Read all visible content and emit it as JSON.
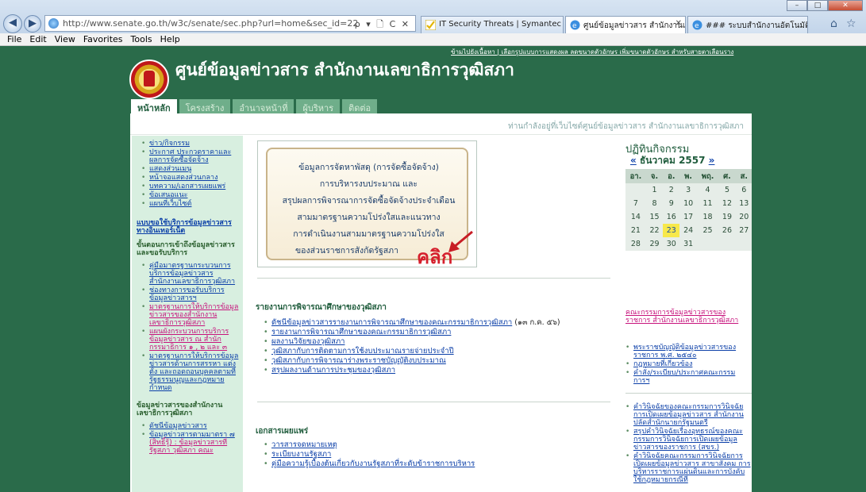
{
  "browser": {
    "url": "http://www.senate.go.th/w3c/senate/sec.php?url=home&sec_id=22",
    "address_tools": "ρ ▾ 🗋 C ✕",
    "tabs": [
      {
        "label": "IT Security Threats | Symantec",
        "icon": "checkmark-icon"
      },
      {
        "label": "ศูนย์ข้อมูลข่าวสาร สำนักงานเล...",
        "icon": "ie-icon"
      },
      {
        "label": "### ระบบสำนักงานอัตโนมัติ ###",
        "icon": "ie-icon"
      }
    ],
    "menu": [
      "File",
      "Edit",
      "View",
      "Favorites",
      "Tools",
      "Help"
    ]
  },
  "site": {
    "top_links": "ข้ามไปยังเนื้อหา | เลือกรูปแบบการแสดงผล ลดขนาดตัวอักษร เพิ่มขนาดตัวอักษร สำหรับสายตาเลือนราง",
    "title": "ศูนย์ข้อมูลข่าวสาร สำนักงานเลขาธิการวุฒิสภา",
    "tabs": [
      "หน้าหลัก",
      "โครงสร้าง",
      "อำนาจหน้าที่",
      "ผู้บริหาร",
      "ติดต่อ"
    ],
    "welcome": "ท่านกำลังอยู่ที่เว็บไซต์ศูนย์ข้อมูลข่าวสาร สำนักงานเลขาธิการวุฒิสภา"
  },
  "left": {
    "menu": [
      "ข่าว/กิจกรรม",
      "ประกาศ ประกวดราคาและผลการจัดซื้อจัดจ้าง",
      "แสดงส่วนเมนู",
      "หน้าจอแสดงส่วนกลาง",
      "บทความ/เอกสารเผยแพร่",
      "ข้อเสนอแนะ",
      "แผนที่เว็บไซต์"
    ],
    "online_form": "แบบขอใช้บริการข้อมูลข่าวสารทางอินเทอร์เน็ต",
    "access_head": "ขั้นตอนการเข้าถึงข้อมูลข่าวสารและขอรับบริการ",
    "access": [
      {
        "label": "คู่มือมาตรฐานกระบวนการบริการข้อมูลข่าวสาร สำนักงานเลขาธิการวุฒิสภา",
        "alt": false
      },
      {
        "label": "ช่องทางการขอรับบริการข้อมูลข่าวสารฯ",
        "alt": false
      },
      {
        "label": "มาตรฐานการให้บริการข้อมูลข่าวสารของสำนักงานเลขาธิการวุฒิสภา",
        "alt": true
      },
      {
        "label": "แผนผังกระบวนการบริการข้อมูลข่าวสาร ณ สำนักกรรมาธิการ ๑ , ๒ และ ๓",
        "alt": true
      },
      {
        "label": "มาตรฐานการให้บริการข้อมูลข่าวสารด้านการสรรหา แต่งตั้ง และถอดถอนบุคคลตามที่รัฐธรรมนูญและกฎหมายกำหนด",
        "alt": false
      }
    ],
    "office_head": "ข้อมูลข่าวสารของสำนักงานเลขาธิการวุฒิสภา",
    "office": [
      {
        "label": "ดัชนีข้อมูลข่าวสาร",
        "alt": false
      },
      {
        "label": "ข้อมูลข่าวสารตามมาตรา ๗",
        "alt": false
      },
      {
        "label": "(สิทธิ์รู้) : ข้อมูลข่าวสารที่รัฐสภา วุฒิสภา คณะ",
        "alt": true
      }
    ]
  },
  "banner": {
    "lines": [
      "ข้อมูลการจัดหาพัสดุ (การจัดซื้อจัดจ้าง)",
      "การบริหารงบประมาณ และ",
      "สรุปผลการพิจารณาการจัดซื้อจัดจ้างประจำเดือน",
      "สามมาตรฐานความโปร่งใสและแนวทาง",
      "การดำเนินงานสามมาตรฐานความโปร่งใส",
      "ของส่วนราชการสังกัดรัฐสภา"
    ],
    "click_label": "คลิก"
  },
  "reports": {
    "heading": "รายงานการพิจารณาศึกษาของวุฒิสภา",
    "items": [
      {
        "label": "ดัชนีข้อมูลข่าวสารรายงานการพิจารณาศึกษาของคณะกรรมาธิการวุฒิสภา",
        "note": " (๑๓ ก.ค. ๕๖)"
      },
      {
        "label": "รายงานการพิจารณาศึกษาของคณะกรรมาธิการวุฒิสภา",
        "note": ""
      },
      {
        "label": "ผลงานวิจัยของวุฒิสภา",
        "note": ""
      },
      {
        "label": "วุฒิสภากับการติดตามการใช้งบประมาณรายจ่ายประจำปี",
        "note": ""
      },
      {
        "label": "วุฒิสภากับการพิจารณาร่างพระราชบัญญัติงบประมาณ",
        "note": ""
      },
      {
        "label": "สรุปผลงานด้านการประชุมของวุฒิสภา",
        "note": ""
      }
    ]
  },
  "publications": {
    "heading": "เอกสารเผยแพร่",
    "items": [
      "วารสารจดหมายเหตุ",
      "ระเบียบงานรัฐสภา",
      "คู่มือความรู้เบื้องต้นเกี่ยวกับงานรัฐสภาที่ระดับข้าราชการบริหาร"
    ]
  },
  "calendar": {
    "title": "ปฏิทินกิจกรรม",
    "prev": "«",
    "month": "ธันวาคม 2557",
    "next": "»",
    "weekdays": [
      "อา.",
      "จ.",
      "อ.",
      "พ.",
      "พฤ.",
      "ศ.",
      "ส."
    ],
    "weeks": [
      [
        "",
        "1",
        "2",
        "3",
        "4",
        "5",
        "6"
      ],
      [
        "7",
        "8",
        "9",
        "10",
        "11",
        "12",
        "13"
      ],
      [
        "14",
        "15",
        "16",
        "17",
        "18",
        "19",
        "20"
      ],
      [
        "21",
        "22",
        "23",
        "24",
        "25",
        "26",
        "27"
      ],
      [
        "28",
        "29",
        "30",
        "31",
        "",
        "",
        ""
      ]
    ],
    "today": "23"
  },
  "right": {
    "committee": "คณะกรรมการข้อมูลข่าวสารของราชการ สำนักงานเลขาธิการวุฒิสภา",
    "laws": [
      "พระราชบัญญัติข้อมูลข่าวสารของราชการ พ.ศ. ๒๕๔๐",
      "กฎหมายที่เกี่ยวข้อง",
      "คำสั่ง/ระเบียบ/ประกาศคณะกรรมการฯ"
    ],
    "rulings": [
      "คำวินิจฉัยของคณะกรรมการวินิจฉัยการเปิดเผยข้อมูลข่าวสาร สำนักงานปลัดสำนักนายกรัฐมนตรี",
      "สรุปคำวินิจฉัยเรื่องอุทธรณ์ของคณะกรรมการวินิจฉัยการเปิดเผยข้อมูลข่าวสารของราชการ (สขร.)",
      "คำวินิจฉัยคณะกรรมการวินิจฉัยการเปิดเผยข้อมูลข่าวสาร สาขาสังคม การบริหารราชการแผ่นดินและการบังคับใช้กฎหมายกรณีที่"
    ]
  },
  "colors": {
    "background": "#2a6b4a",
    "accent": "#1f5c3c",
    "link": "#0b3fa8",
    "alt_link": "#c7127c",
    "click": "#d51f2c",
    "today": "#f7e84a"
  }
}
